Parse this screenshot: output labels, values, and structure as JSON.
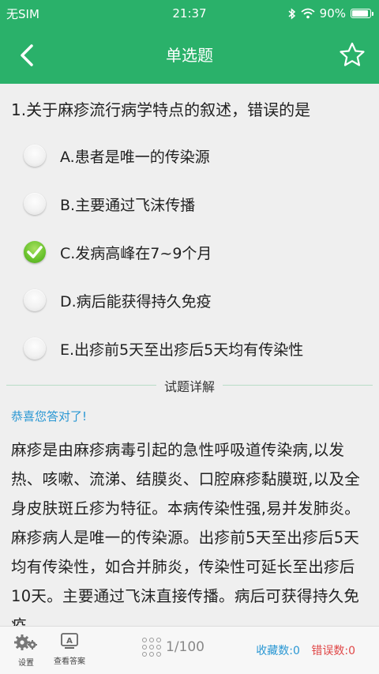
{
  "status": {
    "carrier": "无SIM",
    "time": "21:37",
    "battery": "90%",
    "battery_level": 0.9
  },
  "nav": {
    "title": "单选题"
  },
  "question": {
    "text": "1.关于麻疹流行病学特点的叙述，错误的是"
  },
  "options": [
    {
      "label": "A.患者是唯一的传染源",
      "checked": false
    },
    {
      "label": "B.主要通过飞沫传播",
      "checked": false
    },
    {
      "label": "C.发病高峰在7~9个月",
      "checked": true
    },
    {
      "label": "D.病后能获得持久免疫",
      "checked": false
    },
    {
      "label": "E.出疹前5天至出疹后5天均有传染性",
      "checked": false
    }
  ],
  "detail": {
    "header": "试题详解",
    "result": "恭喜您答对了!",
    "explanation": "麻疹是由麻疹病毒引起的急性呼吸道传染病,以发热、咳嗽、流涕、结膜炎、口腔麻疹黏膜斑,以及全身皮肤斑丘疹为特征。本病传染性强,易并发肺炎。麻疹病人是唯一的传染源。出疹前5天至出疹后5天均有传染性，如合并肺炎，传染性可延长至出疹后10天。主要通过飞沫直接传播。病后可获得持久免疫。"
  },
  "bottom": {
    "settings_label": "设置",
    "answer_label": "查看答案",
    "progress": "1/100",
    "favorites": "收藏数:0",
    "errors": "错误数:0"
  },
  "colors": {
    "primary": "#2ab16a",
    "accent_blue": "#2a97d3",
    "error_red": "#e04848",
    "check_green": "#68c22c"
  }
}
